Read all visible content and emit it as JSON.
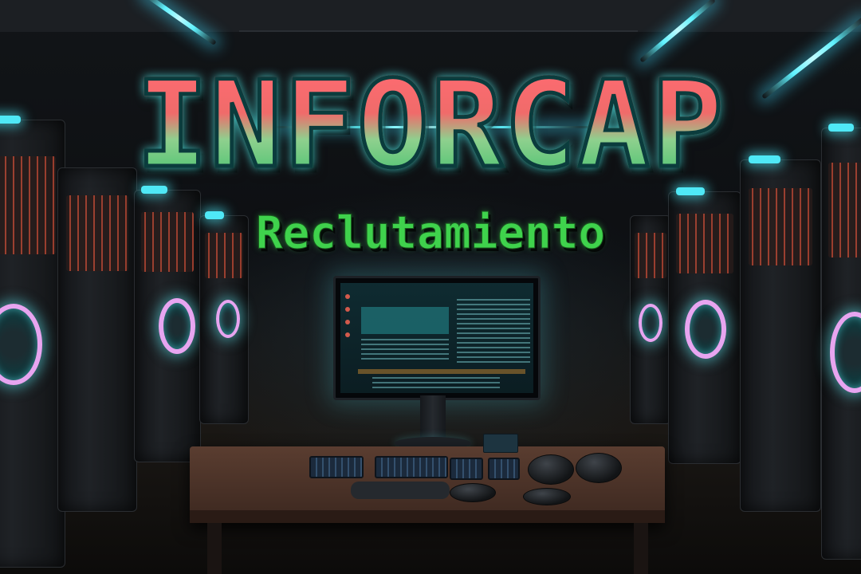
{
  "title": "INFORCAP",
  "subtitle": "Reclutamiento",
  "colors": {
    "title_top": "#ff6b72",
    "title_bottom": "#3fc06c",
    "title_outline": "#0b3c3d",
    "subtitle": "#3fd24c",
    "accent_light": "#5ff2ff",
    "rack_ring": "#e7a5f0"
  },
  "scene": {
    "description_elements": [
      "server-racks",
      "desk",
      "monitor",
      "keyboards",
      "mice"
    ]
  }
}
